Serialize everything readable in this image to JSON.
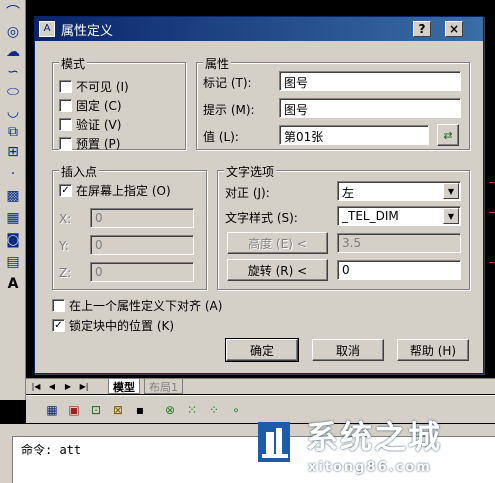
{
  "dialog": {
    "title": "属性定义",
    "help_button": "?",
    "close_button": "×"
  },
  "mode": {
    "label": "模式",
    "items": [
      {
        "label": "不可见 (I)",
        "checked": false
      },
      {
        "label": "固定 (C)",
        "checked": false
      },
      {
        "label": "验证 (V)",
        "checked": false
      },
      {
        "label": "预置 (P)",
        "checked": false
      }
    ]
  },
  "attribute": {
    "label": "属性",
    "tag_label": "标记 (T):",
    "tag_value": "图号",
    "prompt_label": "提示 (M):",
    "prompt_value": "图号",
    "value_label": "值 (L):",
    "value_value": "第01张"
  },
  "insertion": {
    "label": "插入点",
    "specify_label": "在屏幕上指定 (O)",
    "specify_checked": true,
    "x_label": "X:",
    "x_value": "0",
    "y_label": "Y:",
    "y_value": "0",
    "z_label": "Z:",
    "z_value": "0"
  },
  "text_options": {
    "label": "文字选项",
    "justify_label": "对正 (J):",
    "justify_value": "左",
    "style_label": "文字样式 (S):",
    "style_value": "_TEL_DIM",
    "height_button": "高度 (E) <",
    "height_value": "3.5",
    "rotation_button": "旋转 (R) <",
    "rotation_value": "0"
  },
  "options": {
    "align_label": "在上一个属性定义下对齐 (A)",
    "align_checked": false,
    "lock_label": "锁定块中的位置 (K)",
    "lock_checked": true
  },
  "buttons": {
    "ok": "确定",
    "cancel": "取消",
    "help": "帮助 (H)"
  },
  "tabs": {
    "model": "模型",
    "layout1": "布局1"
  },
  "command": {
    "text": "命令: att"
  },
  "watermark": {
    "title": "系统之城",
    "url": "xitong86.com"
  }
}
